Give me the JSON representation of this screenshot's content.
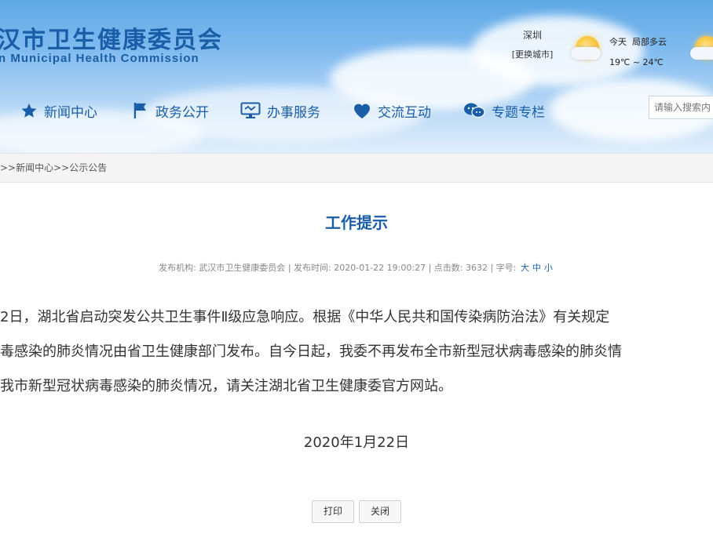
{
  "header": {
    "logo_cn": "汉市卫生健康委员会",
    "logo_en": "n Municipal Health Commission",
    "city": {
      "name": "深圳",
      "change_label": "[更换城市]"
    },
    "weather": {
      "day": "今天",
      "condition": "局部多云",
      "temp": "19℃ ~ 24℃"
    }
  },
  "nav": {
    "items": [
      {
        "label": "新闻中心",
        "icon": "star-icon"
      },
      {
        "label": "政务公开",
        "icon": "flag-icon"
      },
      {
        "label": "办事服务",
        "icon": "monitor-icon"
      },
      {
        "label": "交流互动",
        "icon": "heart-icon"
      },
      {
        "label": "专题专栏",
        "icon": "chat-icon"
      }
    ],
    "search_placeholder": "请输入搜索内"
  },
  "breadcrumb": {
    "prefix": ">>",
    "items": [
      "新闻中心",
      "公示公告"
    ],
    "sep": ">>"
  },
  "article": {
    "title": "工作提示",
    "meta": {
      "publisher_label": "发布机构:",
      "publisher": "武汉市卫生健康委员会",
      "time_label": "| 发布时间:",
      "time": "2020-01-22 19:00:27",
      "clicks_label": "| 点击数:",
      "clicks": "3632",
      "font_label": "| 字号:",
      "sizes": [
        "大",
        "中",
        "小"
      ]
    },
    "lines": [
      "2日，湖北省启动突发公共卫生事件Ⅱ级应急响应。根据《中华人民共和国传染病防治法》有关规定",
      "毒感染的肺炎情况由省卫生健康部门发布。自今日起，我委不再发布全市新型冠状病毒感染的肺炎情",
      "我市新型冠状病毒感染的肺炎情况，请关注湖北省卫生健康委官方网站。"
    ],
    "date": "2020年1月22日"
  },
  "buttons": {
    "print": "打印",
    "close": "关闭"
  },
  "colors": {
    "brand": "#1a5ea8",
    "header_sky": "#7db9ee"
  }
}
